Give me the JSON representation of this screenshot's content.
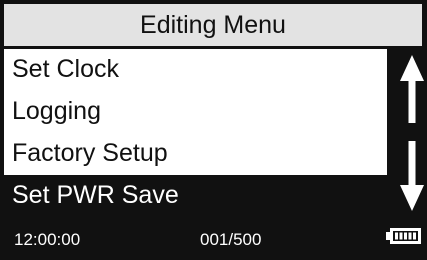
{
  "header": {
    "title": "Editing Menu"
  },
  "menu": {
    "items": [
      {
        "label": "Set Clock"
      },
      {
        "label": "Logging"
      },
      {
        "label": "Factory Setup"
      },
      {
        "label": "Set PWR Save",
        "selected": true
      }
    ]
  },
  "scroll": {
    "up_icon": "arrow-up-icon",
    "down_icon": "arrow-down-icon"
  },
  "status": {
    "time": "12:00:00",
    "record": "001/500",
    "battery_icon": "battery-icon",
    "battery_level": 1.0
  },
  "colors": {
    "frame": "#111111",
    "title_bg": "#e3e3e3",
    "item_bg": "#ffffff",
    "selected_bg": "#111111",
    "text": "#111111",
    "inverse_text": "#ffffff"
  }
}
